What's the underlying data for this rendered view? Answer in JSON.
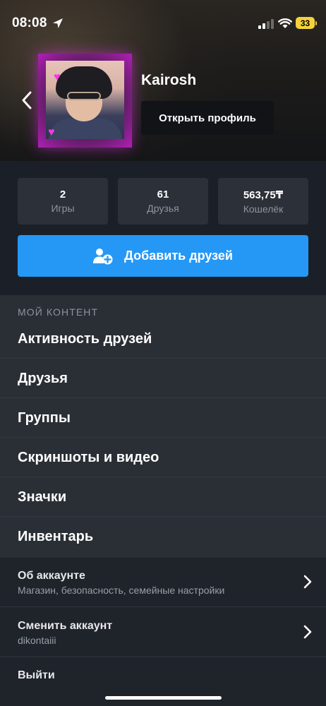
{
  "status_bar": {
    "time": "08:08",
    "battery": "33"
  },
  "profile": {
    "name": "Kairosh",
    "open_profile_label": "Открыть профиль"
  },
  "stats": [
    {
      "value": "2",
      "label": "Игры"
    },
    {
      "value": "61",
      "label": "Друзья"
    },
    {
      "value": "563,75₸",
      "label": "Кошелёк"
    }
  ],
  "add_friends_label": "Добавить друзей",
  "my_content": {
    "title": "МОЙ КОНТЕНТ",
    "items": [
      "Активность друзей",
      "Друзья",
      "Группы",
      "Скриншоты и видео",
      "Значки",
      "Инвентарь"
    ]
  },
  "account": {
    "about_title": "Об аккаунте",
    "about_sub": "Магазин, безопасность, семейные настройки",
    "switch_title": "Сменить аккаунт",
    "switch_sub": "dikontaiii",
    "logout": "Выйти"
  },
  "colors": {
    "accent": "#2598f6",
    "background": "#1b2028",
    "card": "#2c3038",
    "avatar_frame": "#b01fb6"
  },
  "icons": [
    "location-arrow-icon",
    "signal-icon",
    "wifi-icon",
    "battery-icon",
    "back-chevron-icon",
    "add-user-icon",
    "chevron-right-icon"
  ]
}
